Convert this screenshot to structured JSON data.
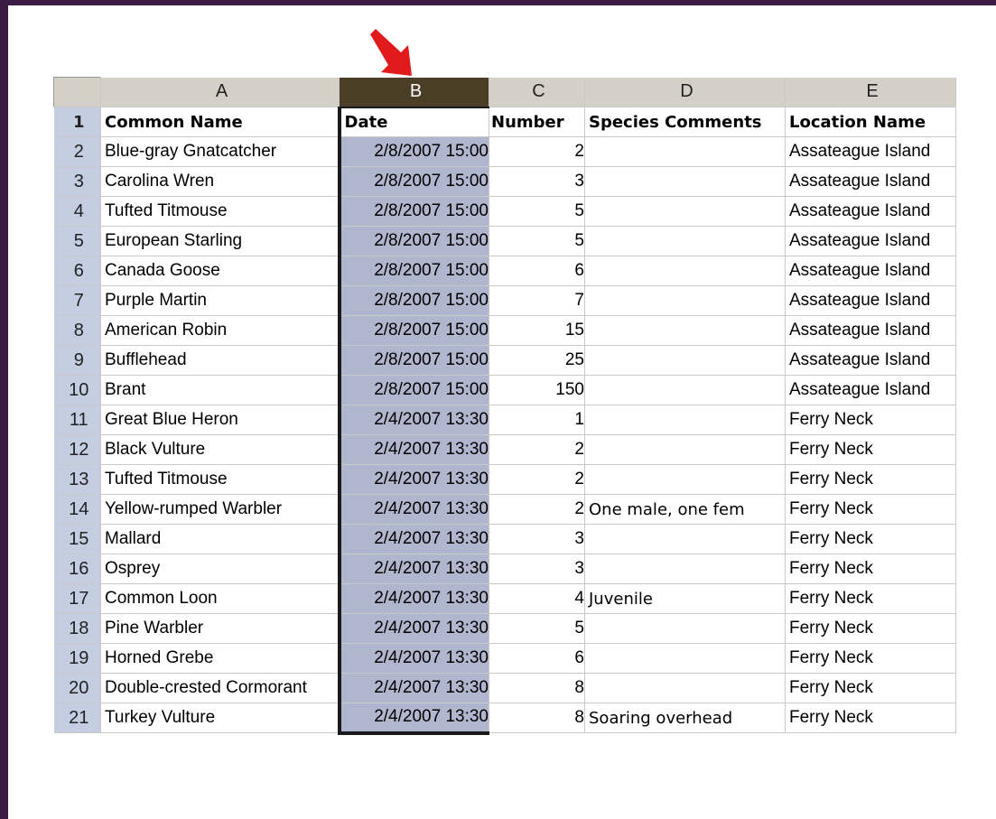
{
  "arrow_color": "#e11b1b",
  "selection_color": "#b1b6cf",
  "columns": [
    "A",
    "B",
    "C",
    "D",
    "E"
  ],
  "header": {
    "row_number": "1",
    "common_name": "Common Name",
    "date": "Date",
    "number": "Number",
    "species_comments": "Species Comments",
    "location_name": "Location Name"
  },
  "rows": [
    {
      "n": "2",
      "name": "Blue-gray Gnatcatcher",
      "date": "2/8/2007 15:00",
      "number": "2",
      "comments": "",
      "location": "Assateague Island"
    },
    {
      "n": "3",
      "name": "Carolina Wren",
      "date": "2/8/2007 15:00",
      "number": "3",
      "comments": "",
      "location": "Assateague Island"
    },
    {
      "n": "4",
      "name": "Tufted Titmouse",
      "date": "2/8/2007 15:00",
      "number": "5",
      "comments": "",
      "location": "Assateague Island"
    },
    {
      "n": "5",
      "name": "European Starling",
      "date": "2/8/2007 15:00",
      "number": "5",
      "comments": "",
      "location": "Assateague Island"
    },
    {
      "n": "6",
      "name": "Canada Goose",
      "date": "2/8/2007 15:00",
      "number": "6",
      "comments": "",
      "location": "Assateague Island"
    },
    {
      "n": "7",
      "name": "Purple Martin",
      "date": "2/8/2007 15:00",
      "number": "7",
      "comments": "",
      "location": "Assateague Island"
    },
    {
      "n": "8",
      "name": "American Robin",
      "date": "2/8/2007 15:00",
      "number": "15",
      "comments": "",
      "location": "Assateague Island"
    },
    {
      "n": "9",
      "name": "Bufflehead",
      "date": "2/8/2007 15:00",
      "number": "25",
      "comments": "",
      "location": "Assateague Island"
    },
    {
      "n": "10",
      "name": "Brant",
      "date": "2/8/2007 15:00",
      "number": "150",
      "comments": "",
      "location": "Assateague Island"
    },
    {
      "n": "11",
      "name": "Great Blue Heron",
      "date": "2/4/2007 13:30",
      "number": "1",
      "comments": "",
      "location": "Ferry Neck"
    },
    {
      "n": "12",
      "name": "Black Vulture",
      "date": "2/4/2007 13:30",
      "number": "2",
      "comments": "",
      "location": "Ferry Neck"
    },
    {
      "n": "13",
      "name": "Tufted Titmouse",
      "date": "2/4/2007 13:30",
      "number": "2",
      "comments": "",
      "location": "Ferry Neck"
    },
    {
      "n": "14",
      "name": "Yellow-rumped Warbler",
      "date": "2/4/2007 13:30",
      "number": "2",
      "comments": "One male, one fem",
      "location": "Ferry Neck"
    },
    {
      "n": "15",
      "name": "Mallard",
      "date": "2/4/2007 13:30",
      "number": "3",
      "comments": "",
      "location": "Ferry Neck"
    },
    {
      "n": "16",
      "name": "Osprey",
      "date": "2/4/2007 13:30",
      "number": "3",
      "comments": "",
      "location": "Ferry Neck"
    },
    {
      "n": "17",
      "name": "Common Loon",
      "date": "2/4/2007 13:30",
      "number": "4",
      "comments": "Juvenile",
      "location": "Ferry Neck"
    },
    {
      "n": "18",
      "name": "Pine Warbler",
      "date": "2/4/2007 13:30",
      "number": "5",
      "comments": "",
      "location": "Ferry Neck"
    },
    {
      "n": "19",
      "name": "Horned Grebe",
      "date": "2/4/2007 13:30",
      "number": "6",
      "comments": "",
      "location": "Ferry Neck"
    },
    {
      "n": "20",
      "name": "Double-crested Cormorant",
      "date": "2/4/2007 13:30",
      "number": "8",
      "comments": "",
      "location": "Ferry Neck"
    },
    {
      "n": "21",
      "name": "Turkey Vulture",
      "date": "2/4/2007 13:30",
      "number": "8",
      "comments": "Soaring overhead",
      "location": "Ferry Neck"
    }
  ]
}
